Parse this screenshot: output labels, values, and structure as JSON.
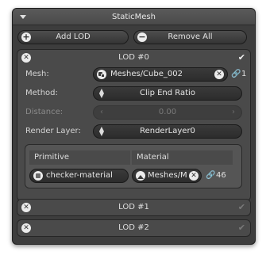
{
  "panel": {
    "title": "StaticMesh",
    "add_label": "Add LOD",
    "remove_label": "Remove All"
  },
  "lods": [
    {
      "title": "LOD #0",
      "mesh_label": "Mesh:",
      "mesh_value": "Meshes/Cube_002",
      "mesh_count": "1",
      "method_label": "Method:",
      "method_value": "Clip End Ratio",
      "distance_label": "Distance:",
      "distance_value": "0.00",
      "render_layer_label": "Render Layer:",
      "render_layer_value": "RenderLayer0",
      "columns": [
        "Primitive",
        "Material"
      ],
      "row": {
        "primitive": "checker-material",
        "material": "Meshes/M",
        "count": "46"
      }
    },
    {
      "title": "LOD #1"
    },
    {
      "title": "LOD #2"
    }
  ],
  "colors": {
    "panel_bg": "#3d3d3d",
    "section_bg": "#4a4a4a",
    "text": "#d6d6d6"
  }
}
